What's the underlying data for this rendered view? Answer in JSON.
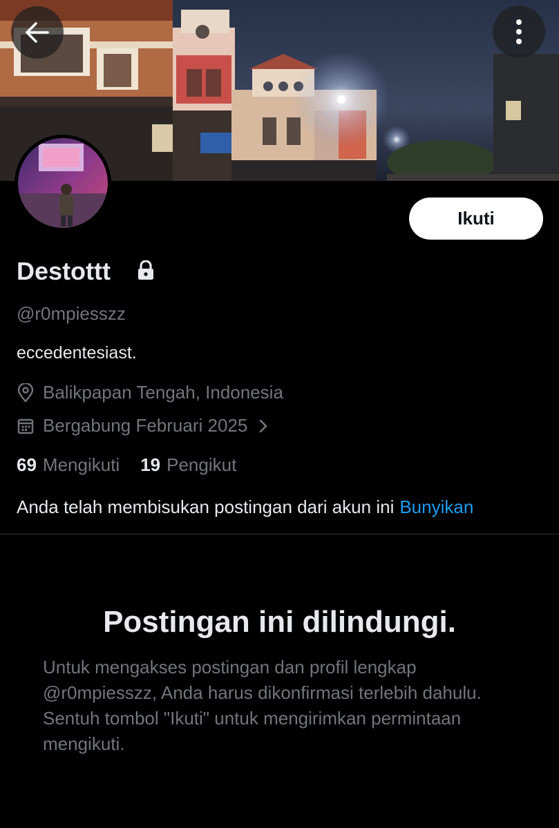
{
  "profile": {
    "display_name": "Destottt",
    "handle": "@r0mpiesszz",
    "bio": "eccedentesiast.",
    "location": "Balikpapan Tengah, Indonesia",
    "joined": "Bergabung Februari 2025",
    "following_count": "69",
    "following_label": "Mengikuti",
    "followers_count": "19",
    "followers_label": "Pengikut"
  },
  "actions": {
    "follow_label": "Ikuti"
  },
  "muted": {
    "notice": "Anda telah membisukan postingan dari akun ini",
    "unmute_label": "Bunyikan"
  },
  "protected": {
    "title": "Postingan ini dilindungi.",
    "description": "Untuk mengakses postingan dan profil lengkap @r0mpiesszz, Anda harus dikonfirmasi terlebih dahulu. Sentuh tombol \"Ikuti\" untuk mengirimkan permintaan mengikuti."
  },
  "icons": {
    "back": "arrow-left-icon",
    "more": "more-vertical-icon",
    "lock": "lock-icon",
    "location": "location-pin-icon",
    "calendar": "calendar-icon",
    "chevron": "chevron-right-icon"
  },
  "colors": {
    "background": "#000000",
    "primary_text": "#e7e9ea",
    "secondary_text": "#71767b",
    "link": "#1d9bf0",
    "follow_button_bg": "#ffffff",
    "divider": "#2f3336"
  }
}
